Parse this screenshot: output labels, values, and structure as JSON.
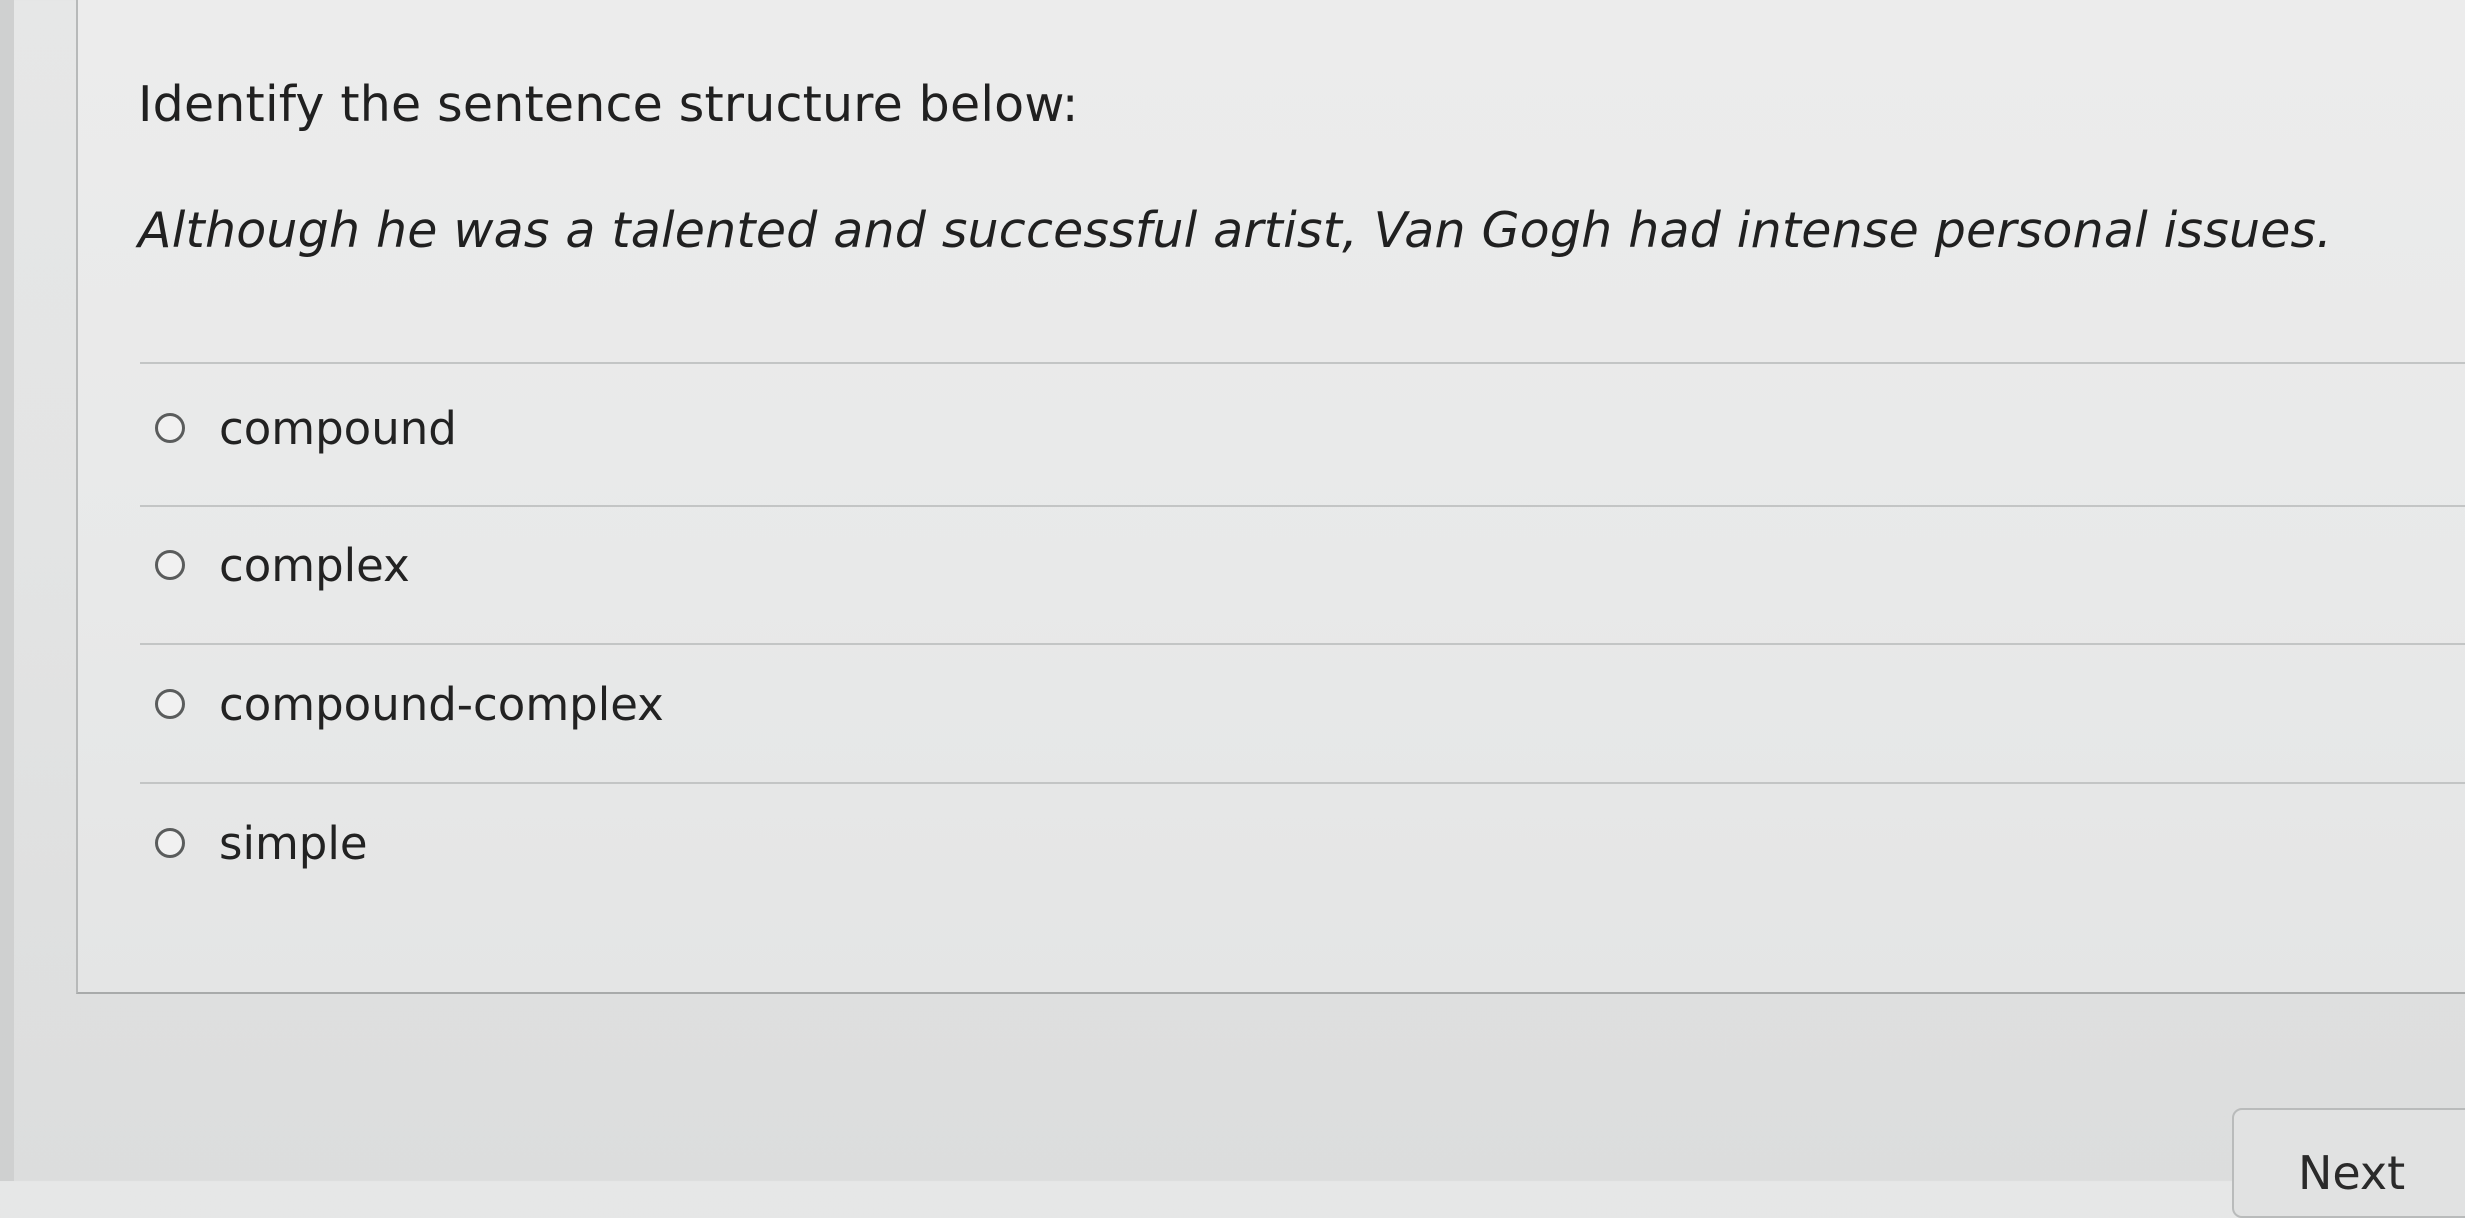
{
  "question": {
    "prompt": "Identify the sentence structure below:",
    "sentence": "Although he was a talented and successful artist, Van Gogh had intense personal issues.",
    "choices": [
      {
        "label": "compound",
        "selected": false
      },
      {
        "label": "complex",
        "selected": false
      },
      {
        "label": "compound-complex",
        "selected": false
      },
      {
        "label": "simple",
        "selected": false
      }
    ]
  },
  "navigation": {
    "next_label": "Next"
  }
}
